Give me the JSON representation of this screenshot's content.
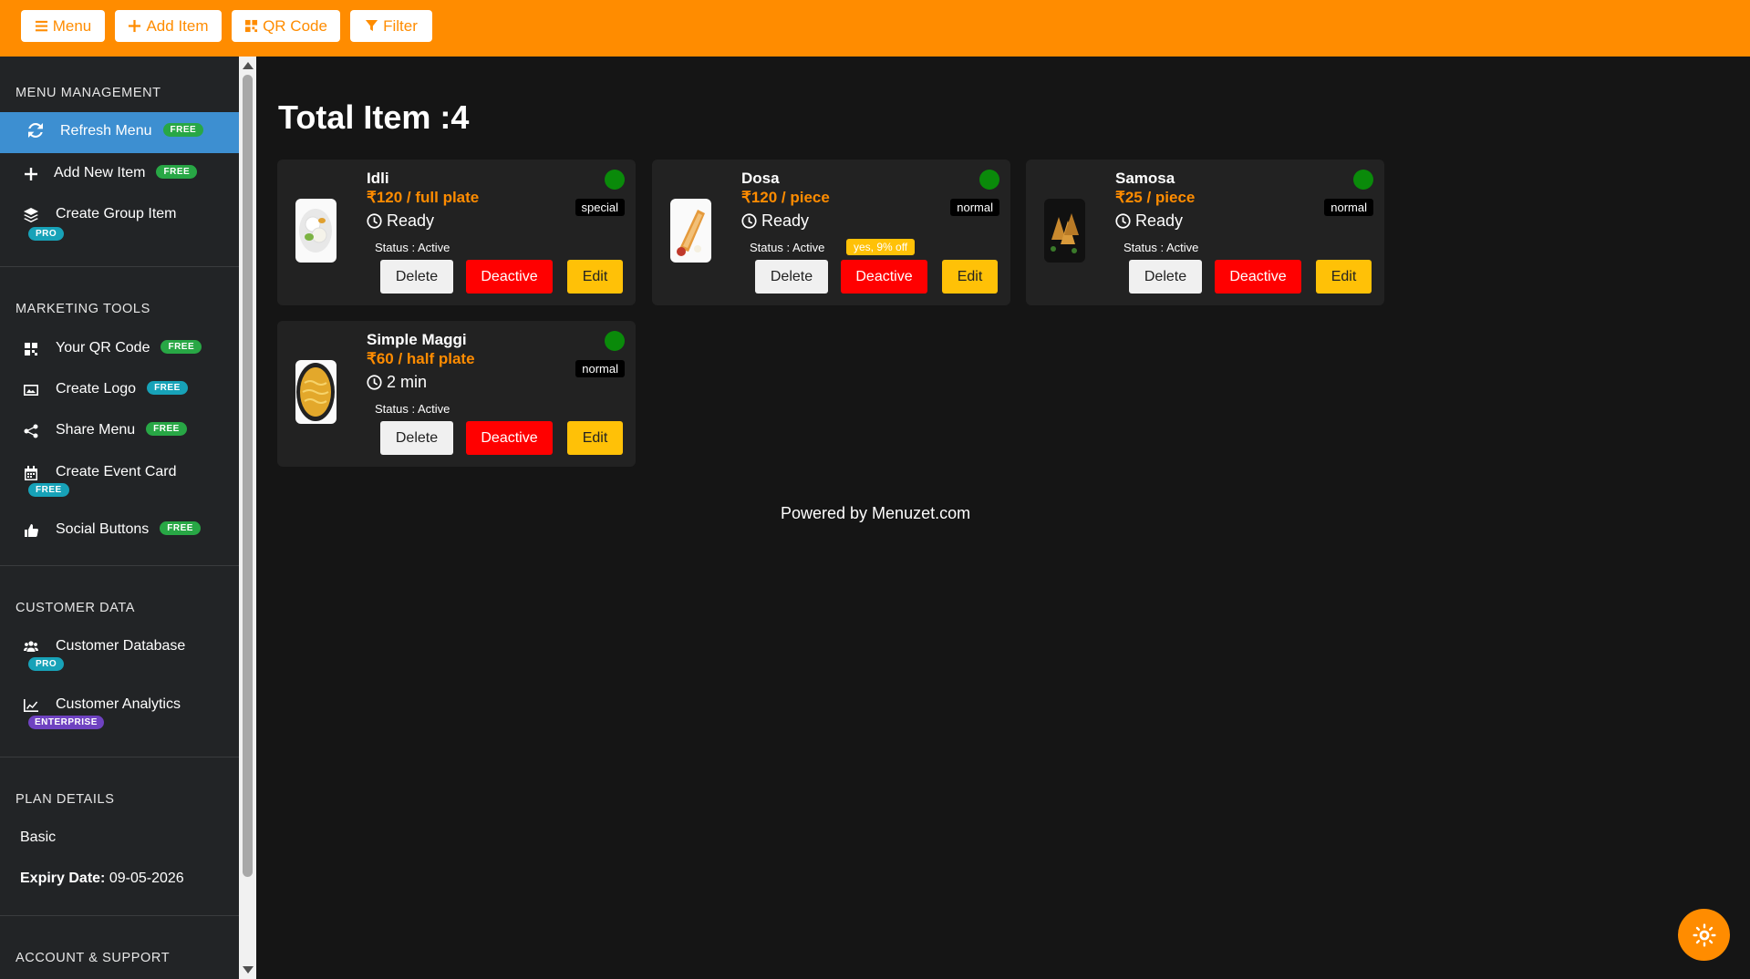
{
  "toolbar": {
    "menu_label": "Menu",
    "add_item_label": "Add Item",
    "qr_code_label": "QR Code",
    "filter_label": "Filter"
  },
  "sidebar": {
    "menu_management": {
      "title": "MENU MANAGEMENT",
      "items": [
        {
          "label": "Refresh Menu",
          "badge": "FREE",
          "icon": "refresh-icon"
        },
        {
          "label": "Add New Item",
          "badge": "FREE",
          "icon": "plus-icon"
        },
        {
          "label": "Create Group Item",
          "badge": "PRO",
          "icon": "layers-icon"
        }
      ]
    },
    "marketing_tools": {
      "title": "MARKETING TOOLS",
      "items": [
        {
          "label": "Your QR Code",
          "badge": "FREE",
          "icon": "qr-code-icon"
        },
        {
          "label": "Create Logo",
          "badge": "FREE",
          "icon": "image-icon"
        },
        {
          "label": "Share Menu",
          "badge": "FREE",
          "icon": "share-icon"
        },
        {
          "label": "Create Event Card",
          "badge": "FREE",
          "icon": "calendar-icon"
        },
        {
          "label": "Social Buttons",
          "badge": "FREE",
          "icon": "thumbs-up-icon"
        }
      ]
    },
    "customer_data": {
      "title": "CUSTOMER DATA",
      "items": [
        {
          "label": "Customer Database",
          "badge": "PRO",
          "icon": "users-icon"
        },
        {
          "label": "Customer Analytics",
          "badge": "ENTERPRISE",
          "icon": "chart-line-icon"
        }
      ]
    },
    "plan_details": {
      "title": "PLAN DETAILS",
      "plan": "Basic",
      "expiry_label": "Expiry Date:",
      "expiry_value": "09-05-2026"
    },
    "account_support": {
      "title": "ACCOUNT & SUPPORT"
    }
  },
  "main": {
    "title": "Total Item :4",
    "buttons": {
      "delete": "Delete",
      "deactive": "Deactive",
      "edit": "Edit"
    },
    "items": [
      {
        "name": "Idli",
        "price": "₹120 / full plate",
        "time": "Ready",
        "status": "Status : Active",
        "tag": "special",
        "offer": ""
      },
      {
        "name": "Dosa",
        "price": "₹120 / piece",
        "time": "Ready",
        "status": "Status : Active",
        "tag": "normal",
        "offer": "yes, 9% off"
      },
      {
        "name": "Samosa",
        "price": "₹25 / piece",
        "time": "Ready",
        "status": "Status : Active",
        "tag": "normal",
        "offer": ""
      },
      {
        "name": "Simple Maggi",
        "price": "₹60 / half plate",
        "time": "2 min",
        "status": "Status : Active",
        "tag": "normal",
        "offer": ""
      }
    ],
    "footer": "Powered by Menuzet.com"
  },
  "colors": {
    "accent": "#ff8c00",
    "active_dot": "#0a8a0a",
    "delete_btn": "#f0f0f0",
    "deactive_btn": "#ff0000",
    "edit_btn": "#ffc107",
    "sidebar_active": "#3d8fd1"
  }
}
